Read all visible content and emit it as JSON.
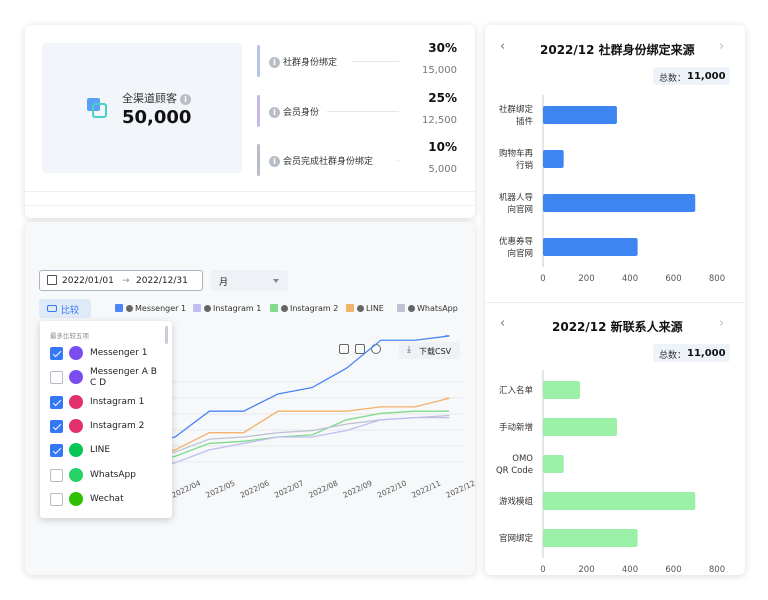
{
  "summary": {
    "total_label": "全渠道顾客",
    "total_value": "50,000",
    "stats": [
      {
        "label": "社群身份绑定",
        "percent": "30%",
        "count": "15,000",
        "color": "#b3c6ea"
      },
      {
        "label": "会员身份",
        "percent": "25%",
        "count": "12,500",
        "color": "#c7b7ea"
      },
      {
        "label": "会员完成社群身份绑定",
        "percent": "10%",
        "count": "5,000",
        "color": "#b8bcc4"
      }
    ]
  },
  "filters": {
    "date_start": "2022/01/01",
    "date_end": "2022/12/31",
    "period": "月",
    "compare_label": "比较"
  },
  "legend": [
    {
      "name": "Messenger 1",
      "color": "#4a86f5"
    },
    {
      "name": "Instagram 1",
      "color": "#c1bdf0"
    },
    {
      "name": "Instagram 2",
      "color": "#7edc8a"
    },
    {
      "name": "LINE",
      "color": "#f2b26b"
    },
    {
      "name": "WhatsApp",
      "color": "#bfc3d1"
    }
  ],
  "toolbar": {
    "download_label": "下载CSV"
  },
  "dropdown": {
    "hint": "最多比较五项",
    "items": [
      {
        "name": "Messenger 1",
        "checked": true,
        "icon": "messenger-icon"
      },
      {
        "name": "Messenger A B C D",
        "checked": false,
        "icon": "messenger-icon"
      },
      {
        "name": "Instagram 1",
        "checked": true,
        "icon": "instagram-icon"
      },
      {
        "name": "Instagram 2",
        "checked": true,
        "icon": "instagram-icon"
      },
      {
        "name": "LINE",
        "checked": true,
        "icon": "line-icon"
      },
      {
        "name": "WhatsApp",
        "checked": false,
        "icon": "whatsapp-icon"
      },
      {
        "name": "Wechat",
        "checked": false,
        "icon": "wechat-icon"
      }
    ]
  },
  "chart_data": [
    {
      "type": "line",
      "x": [
        "2022/04",
        "2022/05",
        "2022/06",
        "2022/07",
        "2022/08",
        "2022/09",
        "2022/10",
        "2022/11",
        "2022/12"
      ],
      "series": [
        {
          "name": "Messenger 1",
          "color": "#4a86f5",
          "values": [
            3.0,
            4.2,
            4.2,
            5.0,
            5.3,
            6.2,
            7.5,
            7.5,
            7.7
          ]
        },
        {
          "name": "LINE",
          "color": "#f2b26b",
          "values": [
            2.4,
            3.2,
            3.2,
            4.2,
            4.2,
            4.2,
            4.4,
            4.4,
            4.8
          ]
        },
        {
          "name": "Instagram 2",
          "color": "#7edc8a",
          "values": [
            2.1,
            2.7,
            2.8,
            3.0,
            3.1,
            3.8,
            4.1,
            4.2,
            4.2
          ]
        },
        {
          "name": "WhatsApp",
          "color": "#bfc3d1",
          "values": [
            2.3,
            2.9,
            3.0,
            3.2,
            3.3,
            3.6,
            3.8,
            3.9,
            4.0
          ]
        },
        {
          "name": "Instagram 1",
          "color": "#c1bdf0",
          "values": [
            1.8,
            2.4,
            2.7,
            3.0,
            3.0,
            3.3,
            3.8,
            3.9,
            3.9
          ]
        }
      ]
    },
    {
      "type": "bar",
      "title": "2022/12 社群身份绑定来源",
      "total_label": "总数：",
      "total_value": "11,000",
      "categories": [
        "社群绑定插件",
        "购物车再行销",
        "机器人导向官网",
        "优惠券导向官网"
      ],
      "category_lines": [
        [
          "社群绑定",
          "插件"
        ],
        [
          "购物车再",
          "行销"
        ],
        [
          "机器人导",
          "向官网"
        ],
        [
          "优惠券导",
          "向官网"
        ]
      ],
      "values": [
        340,
        95,
        700,
        435
      ],
      "xlim": [
        0,
        800
      ],
      "xticks": [
        0,
        200,
        400,
        600,
        800
      ],
      "color": "#3d86f2"
    },
    {
      "type": "bar",
      "title": "2022/12 新联系人来源",
      "total_label": "总数：",
      "total_value": "11,000",
      "categories": [
        "汇入名单",
        "手动新增",
        "OMO QR Code",
        "游戏模组",
        "官网绑定"
      ],
      "category_lines": [
        [
          "汇入名单"
        ],
        [
          "手动新增"
        ],
        [
          "OMO",
          "QR Code"
        ],
        [
          "游戏模组"
        ],
        [
          "官网绑定"
        ]
      ],
      "values": [
        170,
        340,
        95,
        700,
        435
      ],
      "xlim": [
        0,
        800
      ],
      "xticks": [
        0,
        200,
        400,
        600,
        800
      ],
      "color": "#9af0a6"
    }
  ]
}
